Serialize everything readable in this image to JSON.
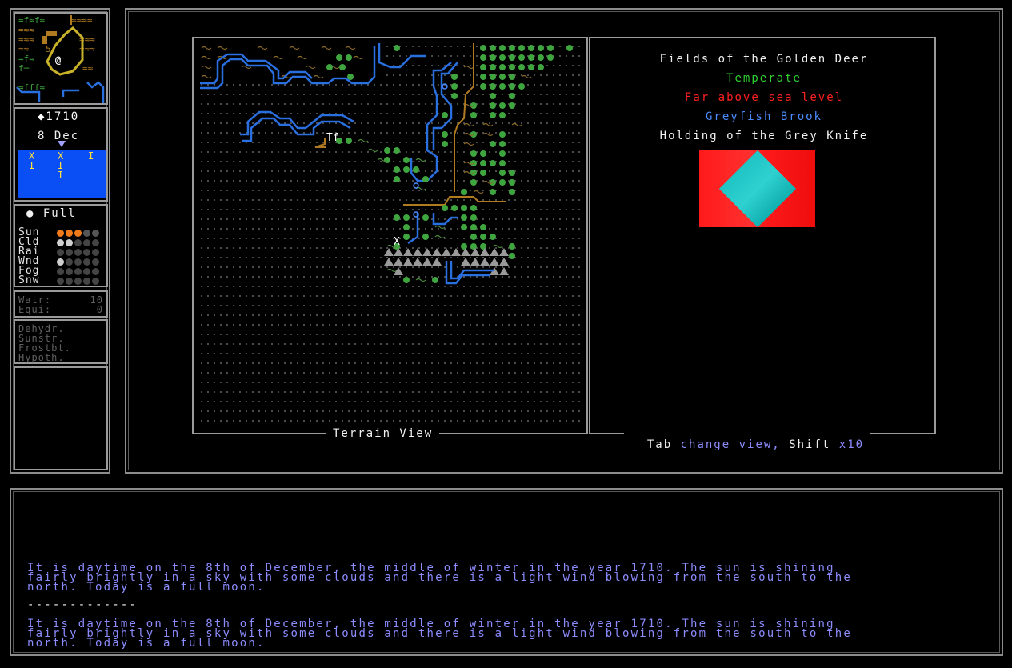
{
  "sidebar": {
    "year": "◆1710",
    "date": "8 Dec",
    "calendar_marks": [
      "X",
      "X",
      "I",
      "I",
      "I",
      "I"
    ],
    "moon_phase": "● Full",
    "weather": [
      {
        "label": "Sun",
        "level": 3
      },
      {
        "label": "Cld",
        "level": 2
      },
      {
        "label": "Rai",
        "level": 0
      },
      {
        "label": "Wnd",
        "level": 1
      },
      {
        "label": "Fog",
        "level": 0
      },
      {
        "label": "Snw",
        "level": 0
      }
    ],
    "water_label": "Watr:",
    "water_value": "10",
    "equip_label": "Equi:",
    "equip_value": "0",
    "conditions": [
      "Dehydr.",
      "Sunstr.",
      "Frostbt.",
      "Hypoth."
    ]
  },
  "map": {
    "caption": "Terrain View"
  },
  "info": {
    "region": "Fields of the Golden Deer",
    "climate": "Temperate",
    "elevation": "Far above sea level",
    "river": "Greyfish Brook",
    "holding": "Holding of the Grey Knife",
    "flag_colors": {
      "field": "#ff1a1a",
      "diamond": "#1fc4c4"
    },
    "hint_key1": "Tab",
    "hint_action1": "change view,",
    "hint_key2": "Shift",
    "hint_action2": "x10"
  },
  "log": {
    "messages": [
      "It is daytime on the 8th of December, the middle of winter in the year 1710. The sun is shining\nfairly brightly in a sky with some clouds and there is a light wind blowing from the south to the\nnorth. Today is a full moon.",
      "It is daytime on the 8th of December, the middle of winter in the year 1710. The sun is shining\nfairly brightly in a sky with some clouds and there is a light wind blowing from the south to the\nnorth. Today is a full moon."
    ],
    "separator": "-------------"
  },
  "colors": {
    "climate": "#2fd12f",
    "elevation": "#ff2020",
    "river": "#4a8cff",
    "log_text": "#8c8cff"
  }
}
